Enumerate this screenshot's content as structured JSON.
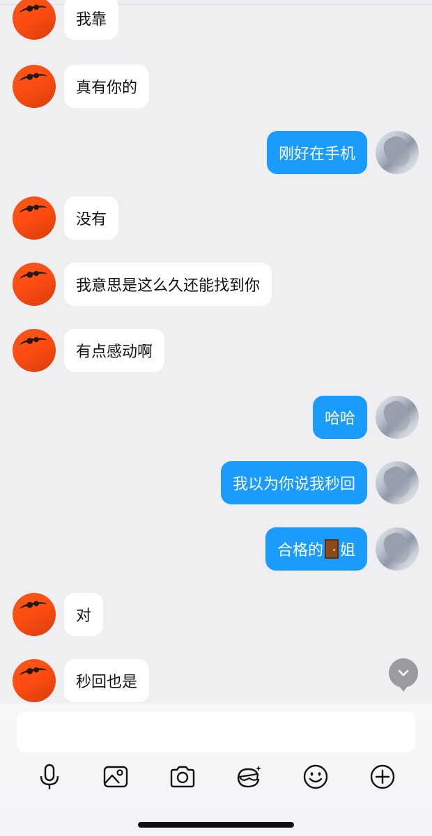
{
  "messages": [
    {
      "side": "left",
      "text": "我靠"
    },
    {
      "side": "left",
      "text": "真有你的"
    },
    {
      "side": "right",
      "text": "刚好在手机"
    },
    {
      "side": "left",
      "text": "没有"
    },
    {
      "side": "left",
      "text": "我意思是这么久还能找到你"
    },
    {
      "side": "left",
      "text": "有点感动啊"
    },
    {
      "side": "right",
      "text": "哈哈"
    },
    {
      "side": "right",
      "text": "我以为你说我秒回"
    },
    {
      "side": "right",
      "text_before": "合格的",
      "emoji": "door",
      "text_after": "姐"
    },
    {
      "side": "left",
      "text": "对"
    },
    {
      "side": "left",
      "text": "秒回也是"
    }
  ],
  "composer": {
    "value": "",
    "placeholder": ""
  },
  "toolbar": {
    "icons": [
      "microphone-icon",
      "image-icon",
      "camera-icon",
      "sticker-icon",
      "emoji-icon",
      "plus-icon"
    ]
  },
  "colors": {
    "background": "#efeff1",
    "incoming_bubble": "#ffffff",
    "outgoing_bubble": "#1a9cff",
    "outgoing_text": "#ffffff"
  }
}
